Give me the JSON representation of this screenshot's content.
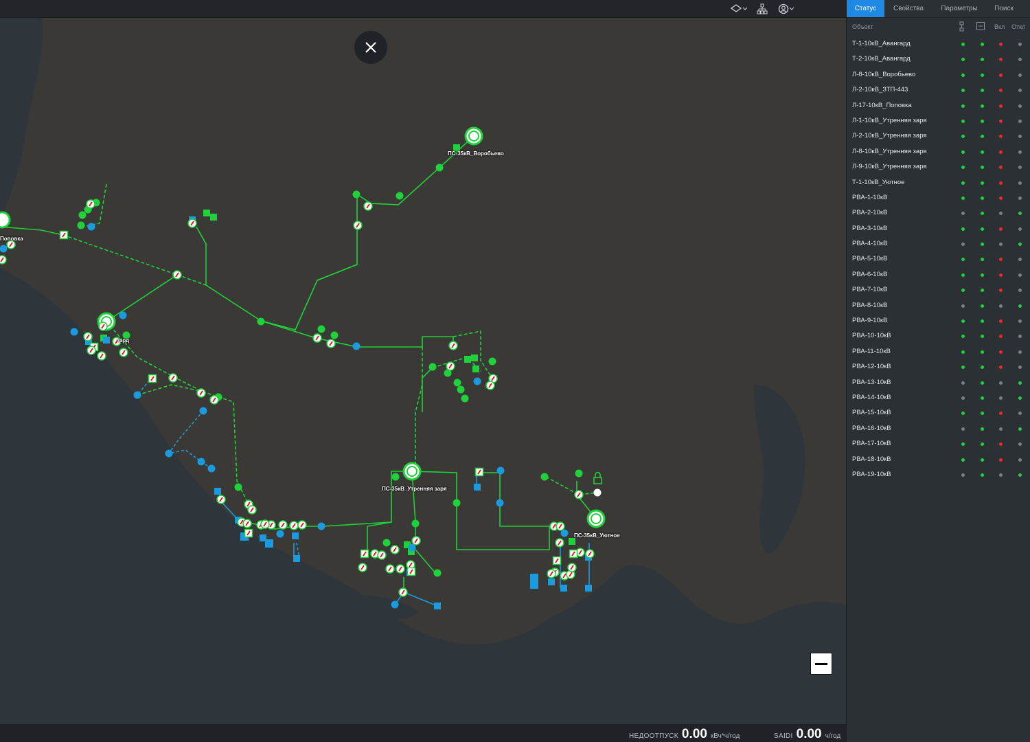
{
  "topbar": {
    "layers_icon": "layers-icon",
    "hierarchy_icon": "hierarchy-icon",
    "user_icon": "user-icon"
  },
  "map": {
    "labels": {
      "vorobyevo": "ПС-35кВ_Воробьево",
      "avangard": "тард",
      "popovka": "Поповка",
      "utrennyaya": "ПС-35кВ_Утренняя заря",
      "uyutnoe": "ПС-35кВ_Уютное"
    },
    "colors": {
      "energized": "#1fd13a",
      "de_energized": "#1a9be0",
      "on": "#ff2020",
      "off": "#7a7f86",
      "land": "#3b3a37",
      "sea": "#2d3439"
    }
  },
  "metrics": {
    "undersupply_label": "НЕДООТПУСК",
    "undersupply_value": "0.00",
    "undersupply_unit": "кВч*ч/год",
    "saidi_label": "SAIDI",
    "saidi_value": "0.00",
    "saidi_unit": "ч/год"
  },
  "panel": {
    "tabs": [
      "Статус",
      "Свойства",
      "Параметры",
      "Поиск"
    ],
    "active_tab": 0,
    "columns": {
      "object": "Объект",
      "on": "Вкл",
      "off": "Откл"
    },
    "rows": [
      {
        "name": "Т-1-10кВ_Авангард",
        "s": [
          "g",
          "g",
          "r",
          "x"
        ]
      },
      {
        "name": "Т-2-10кВ_Авангард",
        "s": [
          "g",
          "g",
          "r",
          "x"
        ]
      },
      {
        "name": "Л-8-10кВ_Воробьево",
        "s": [
          "g",
          "g",
          "r",
          "x"
        ]
      },
      {
        "name": "Л-2-10кВ_ЗТП-443",
        "s": [
          "g",
          "g",
          "r",
          "x"
        ]
      },
      {
        "name": "Л-17-10кВ_Поповка",
        "s": [
          "g",
          "g",
          "r",
          "x"
        ]
      },
      {
        "name": "Л-1-10кВ_Утренняя заря",
        "s": [
          "g",
          "g",
          "r",
          "x"
        ]
      },
      {
        "name": "Л-2-10кВ_Утренняя заря",
        "s": [
          "g",
          "g",
          "r",
          "x"
        ]
      },
      {
        "name": "Л-8-10кВ_Утренняя заря",
        "s": [
          "g",
          "g",
          "r",
          "x"
        ]
      },
      {
        "name": "Л-9-10кВ_Утренняя заря",
        "s": [
          "g",
          "g",
          "r",
          "x"
        ]
      },
      {
        "name": "Т-1-10кВ_Уютное",
        "s": [
          "g",
          "g",
          "r",
          "x"
        ]
      },
      {
        "name": "РВА-1-10кВ",
        "s": [
          "g",
          "g",
          "r",
          "x"
        ]
      },
      {
        "name": "РВА-2-10кВ",
        "s": [
          "x",
          "g",
          "x",
          "g"
        ]
      },
      {
        "name": "РВА-3-10кВ",
        "s": [
          "g",
          "g",
          "r",
          "x"
        ]
      },
      {
        "name": "РВА-4-10кВ",
        "s": [
          "x",
          "g",
          "x",
          "g"
        ]
      },
      {
        "name": "РВА-5-10кВ",
        "s": [
          "g",
          "g",
          "r",
          "x"
        ]
      },
      {
        "name": "РВА-6-10кВ",
        "s": [
          "g",
          "g",
          "r",
          "x"
        ]
      },
      {
        "name": "РВА-7-10кВ",
        "s": [
          "g",
          "g",
          "r",
          "x"
        ]
      },
      {
        "name": "РВА-8-10кВ",
        "s": [
          "x",
          "g",
          "x",
          "g"
        ]
      },
      {
        "name": "РВА-9-10кВ",
        "s": [
          "g",
          "g",
          "r",
          "x"
        ]
      },
      {
        "name": "РВА-10-10кВ",
        "s": [
          "g",
          "g",
          "r",
          "x"
        ]
      },
      {
        "name": "РВА-11-10кВ",
        "s": [
          "g",
          "g",
          "r",
          "x"
        ]
      },
      {
        "name": "РВА-12-10кВ",
        "s": [
          "g",
          "g",
          "r",
          "x"
        ]
      },
      {
        "name": "РВА-13-10кВ",
        "s": [
          "x",
          "g",
          "x",
          "g"
        ]
      },
      {
        "name": "РВА-14-10кВ",
        "s": [
          "x",
          "g",
          "x",
          "g"
        ]
      },
      {
        "name": "РВА-15-10кВ",
        "s": [
          "g",
          "g",
          "r",
          "x"
        ]
      },
      {
        "name": "РВА-16-10кВ",
        "s": [
          "x",
          "g",
          "x",
          "g"
        ]
      },
      {
        "name": "РВА-17-10кВ",
        "s": [
          "g",
          "g",
          "r",
          "x"
        ]
      },
      {
        "name": "РВА-18-10кВ",
        "s": [
          "g",
          "g",
          "r",
          "x"
        ]
      },
      {
        "name": "РВА-19-10кВ",
        "s": [
          "x",
          "g",
          "x",
          "g"
        ]
      }
    ]
  }
}
